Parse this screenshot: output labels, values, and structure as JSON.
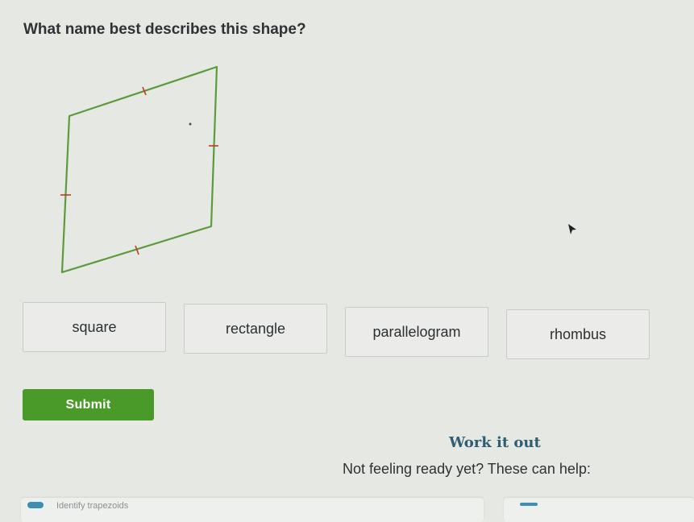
{
  "question": {
    "text": "What name best describes this shape?"
  },
  "options": [
    {
      "label": "square"
    },
    {
      "label": "rectangle"
    },
    {
      "label": "parallelogram"
    },
    {
      "label": "rhombus"
    }
  ],
  "submit": {
    "label": "Submit"
  },
  "help": {
    "heading": "Work it out",
    "subtext": "Not feeling ready yet? These can help:",
    "cards": [
      {
        "label": "Identify trapezoids"
      },
      {
        "label": ""
      }
    ]
  },
  "icons": {
    "cursor": "mouse-pointer-icon",
    "help_card": "skill-icon"
  },
  "colors": {
    "accent": "#4a9a2a",
    "shape_stroke": "#5c9a3c",
    "tick_marks": "#c0392b",
    "heading": "#2f5d73",
    "background": "#e6e8e4"
  }
}
